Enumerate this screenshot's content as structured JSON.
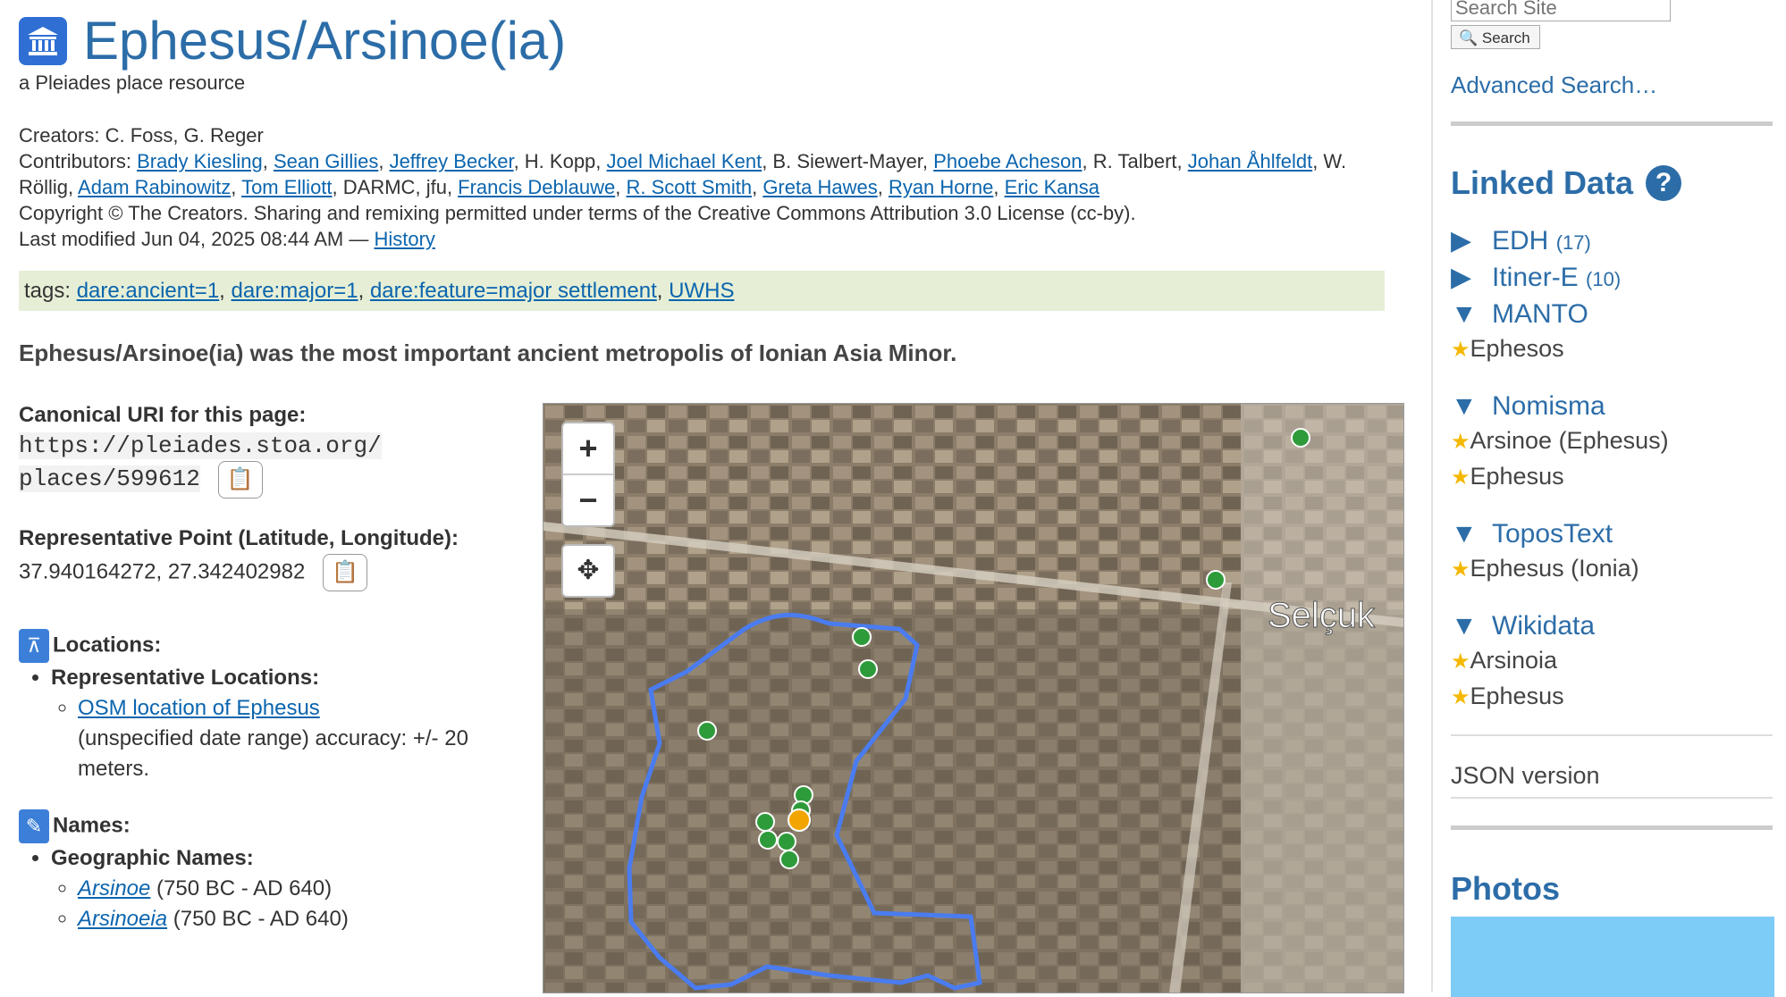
{
  "page": {
    "title": "Ephesus/Arsinoe(ia)",
    "subtitle": "a Pleiades place resource",
    "creators_label": "Creators: ",
    "creators": "C. Foss, G. Reger",
    "contributors_label": "Contributors: ",
    "contributors": [
      {
        "name": "Brady Kiesling",
        "link": true
      },
      {
        "name": "Sean Gillies",
        "link": true
      },
      {
        "name": "Jeffrey Becker",
        "link": true
      },
      {
        "name": "H. Kopp",
        "link": false
      },
      {
        "name": "Joel Michael Kent",
        "link": true
      },
      {
        "name": "B. Siewert-Mayer",
        "link": false
      },
      {
        "name": "Phoebe Acheson",
        "link": true
      },
      {
        "name": "R. Talbert",
        "link": false
      },
      {
        "name": "Johan Åhlfeldt",
        "link": true
      },
      {
        "name": "W. Röllig",
        "link": false
      },
      {
        "name": "Adam Rabinowitz",
        "link": true
      },
      {
        "name": "Tom Elliott",
        "link": true
      },
      {
        "name": "DARMC",
        "link": false
      },
      {
        "name": "jfu",
        "link": false
      },
      {
        "name": "Francis Deblauwe",
        "link": true
      },
      {
        "name": "R. Scott Smith",
        "link": true
      },
      {
        "name": "Greta Hawes",
        "link": true
      },
      {
        "name": "Ryan Horne",
        "link": true
      },
      {
        "name": "Eric Kansa",
        "link": true
      }
    ],
    "copyright": "Copyright © The Creators. Sharing and remixing permitted under terms of the Creative Commons Attribution 3.0 License (cc-by).",
    "last_modified": "Last modified Jun 04, 2025 08:44 AM — ",
    "history_link": "History",
    "tags_label": "tags: ",
    "tags": [
      "dare:ancient=1",
      "dare:major=1",
      "dare:feature=major settlement",
      "UWHS"
    ],
    "summary": "Ephesus/Arsinoe(ia) was the most important ancient metropolis of Ionian Asia Minor.",
    "canonical_label": "Canonical URI for this page:",
    "canonical_uri_1": "https://pleiades.stoa.org/",
    "canonical_uri_2": "places/599612",
    "rep_point_label": "Representative Point (Latitude, Longitude):",
    "rep_point": "37.940164272, 27.342402982",
    "locations_label": "Locations:",
    "rep_locations_label": "Representative Locations:",
    "osm_link": "OSM location of Ephesus",
    "osm_desc": "(unspecified date range) accuracy: +/- 20 meters.",
    "names_label": "Names:",
    "geo_names_label": "Geographic Names:",
    "names": [
      {
        "name": "Arsinoe",
        "range": " (750 BC - AD 640)"
      },
      {
        "name": "Arsinoeia",
        "range": " (750 BC - AD 640)"
      }
    ]
  },
  "map": {
    "town_label": "Selçuk",
    "zoom_in": "+",
    "zoom_out": "−",
    "pan_icon": "✥"
  },
  "sidebar": {
    "search_placeholder": "Search Site",
    "search_button": "🔍 Search",
    "advanced": "Advanced Search…",
    "linked_data": "Linked Data",
    "help": "?",
    "groups": [
      {
        "name": "EDH",
        "count": "(17)",
        "expanded": false,
        "items": []
      },
      {
        "name": "Itiner-E",
        "count": "(10)",
        "expanded": false,
        "items": []
      },
      {
        "name": "MANTO",
        "count": "",
        "expanded": true,
        "items": [
          "Ephesos"
        ]
      },
      {
        "name": "Nomisma",
        "count": "",
        "expanded": true,
        "items": [
          "Arsinoe (Ephesus)",
          "Ephesus"
        ]
      },
      {
        "name": "ToposText",
        "count": "",
        "expanded": true,
        "items": [
          "Ephesus (Ionia)"
        ]
      },
      {
        "name": "Wikidata",
        "count": "",
        "expanded": true,
        "items": [
          "Arsinoia",
          "Ephesus"
        ]
      }
    ],
    "json_version": "JSON version",
    "photos": "Photos"
  },
  "colors": {
    "accent": "#2c6da8",
    "link": "#0b65ae",
    "tag_bg": "#e6efd6",
    "polygon": "#4a7cf0",
    "marker": "#2e9b3a"
  }
}
